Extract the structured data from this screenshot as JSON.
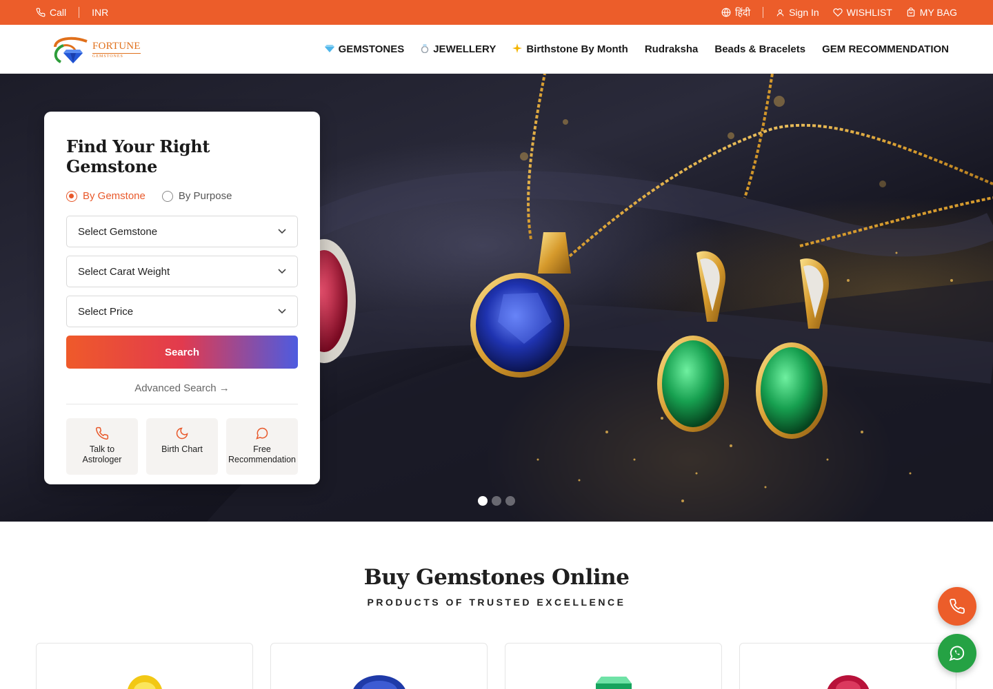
{
  "topbar": {
    "call_label": "Call",
    "currency_label": "INR",
    "language_label": "हिंदी",
    "signin_label": "Sign In",
    "wishlist_label": "WISHLIST",
    "bag_label": "MY BAG"
  },
  "header": {
    "logo_brand": "FORTUNE",
    "logo_sub": "GEMSTONES",
    "nav": [
      {
        "label": "GEMSTONES",
        "icon": "diamond-icon"
      },
      {
        "label": "JEWELLERY",
        "icon": "ring-icon"
      },
      {
        "label": "Birthstone By Month",
        "icon": "sparkle-icon"
      },
      {
        "label": "Rudraksha"
      },
      {
        "label": "Beads & Bracelets"
      },
      {
        "label": "GEM RECOMMENDATION"
      }
    ]
  },
  "finder": {
    "title": "Find Your Right Gemstone",
    "radio_gemstone": "By Gemstone",
    "radio_purpose": "By Purpose",
    "selected_mode": "By Gemstone",
    "select_gemstone": "Select Gemstone",
    "select_carat": "Select Carat Weight",
    "select_price": "Select Price",
    "search_label": "Search",
    "advanced_label": "Advanced Search",
    "quick": [
      {
        "label": "Talk to Astrologer",
        "icon": "phone-icon"
      },
      {
        "label": "Birth Chart",
        "icon": "moon-icon"
      },
      {
        "label": "Free Recommendation",
        "icon": "chat-icon"
      }
    ]
  },
  "carousel": {
    "slides": 3,
    "active": 1
  },
  "section": {
    "title": "Buy Gemstones Online",
    "subtitle": "PRODUCTS OF TRUSTED EXCELLENCE"
  },
  "products": [
    {
      "gem": "yellow-sapphire",
      "color": "#f2c815"
    },
    {
      "gem": "blue-sapphire",
      "color": "#1f3aa8"
    },
    {
      "gem": "emerald",
      "color": "#17a35d"
    },
    {
      "gem": "ruby",
      "color": "#b8123a"
    }
  ],
  "colors": {
    "accent": "#ec5d2a",
    "whatsapp": "#25a244"
  }
}
